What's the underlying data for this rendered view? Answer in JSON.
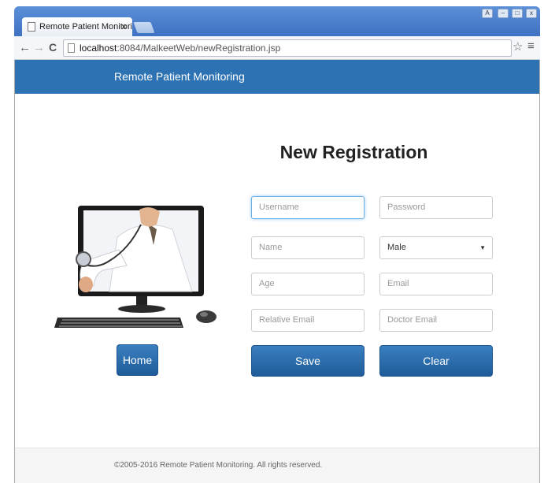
{
  "browser": {
    "tab_title": "Remote Patient Monitorir",
    "tab_close": "×",
    "url_host": "localhost",
    "url_rest": ":8084/MalkeetWeb/newRegistration.jsp",
    "back_glyph": "←",
    "forward_glyph": "→",
    "reload_glyph": "C",
    "star_glyph": "☆",
    "menu_glyph": "≡",
    "window_controls": [
      "A",
      "–",
      "□",
      "x"
    ]
  },
  "navbar": {
    "brand": "Remote Patient Monitoring",
    "color": "#2d72b3"
  },
  "page": {
    "heading": "New Registration"
  },
  "form": {
    "username_placeholder": "Username",
    "password_placeholder": "Password",
    "name_placeholder": "Name",
    "gender_selected": "Male",
    "age_placeholder": "Age",
    "email_placeholder": "Email",
    "relative_email_placeholder": "Relative Email",
    "doctor_email_placeholder": "Doctor Email",
    "save_label": "Save",
    "clear_label": "Clear"
  },
  "home_label": "Home",
  "footer": {
    "text": "©2005-2016 Remote Patient Monitoring. All rights reserved."
  },
  "icons": {
    "page": "page-icon",
    "star": "bookmark-star-icon",
    "menu": "menu-icon",
    "caret": "caret-down-icon"
  }
}
